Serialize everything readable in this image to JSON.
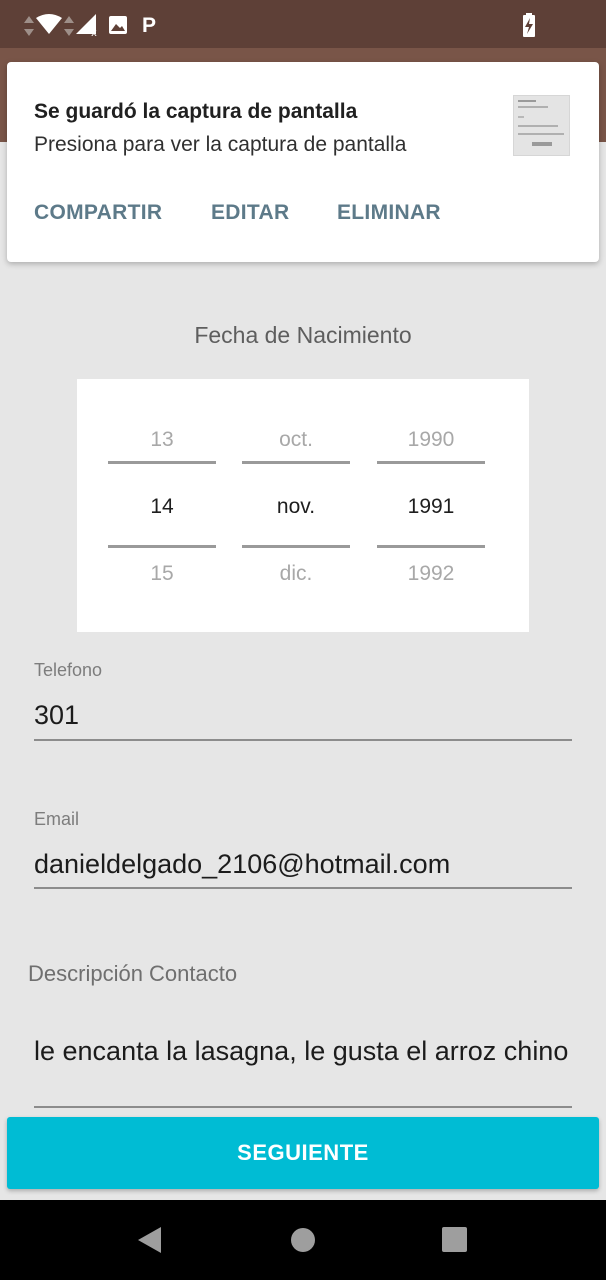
{
  "status_bar": {
    "icons": [
      "data-arrows-icon",
      "wifi-icon",
      "signal-no-sim-icon",
      "image-icon",
      "parking-icon",
      "battery-charging-icon"
    ],
    "color": "#5e4037"
  },
  "notification": {
    "title": "Se guardó la captura de pantalla",
    "text": "Presiona para ver la captura de pantalla",
    "actions": {
      "share": "COMPARTIR",
      "edit": "EDITAR",
      "delete": "ELIMINAR"
    },
    "action_color": "#5d7a89"
  },
  "form": {
    "birth_date_label": "Fecha de Nacimiento",
    "date_picker": {
      "day": {
        "prev": "13",
        "selected": "14",
        "next": "15"
      },
      "month": {
        "prev": "oct.",
        "selected": "nov.",
        "next": "dic."
      },
      "year": {
        "prev": "1990",
        "selected": "1991",
        "next": "1992"
      }
    },
    "phone": {
      "label": "Telefono",
      "value": "301"
    },
    "email": {
      "label": "Email",
      "value": "danieldelgado_2106@hotmail.com"
    },
    "description": {
      "label": "Descripción Contacto",
      "value": "le encanta la lasagna, le gusta el arroz chino"
    },
    "next_button": "SEGUIENTE"
  },
  "colors": {
    "app_bar": "#795548",
    "accent_button": "#00bcd4"
  },
  "nav_bar": {
    "icons": [
      "back-icon",
      "home-icon",
      "recents-icon"
    ]
  }
}
